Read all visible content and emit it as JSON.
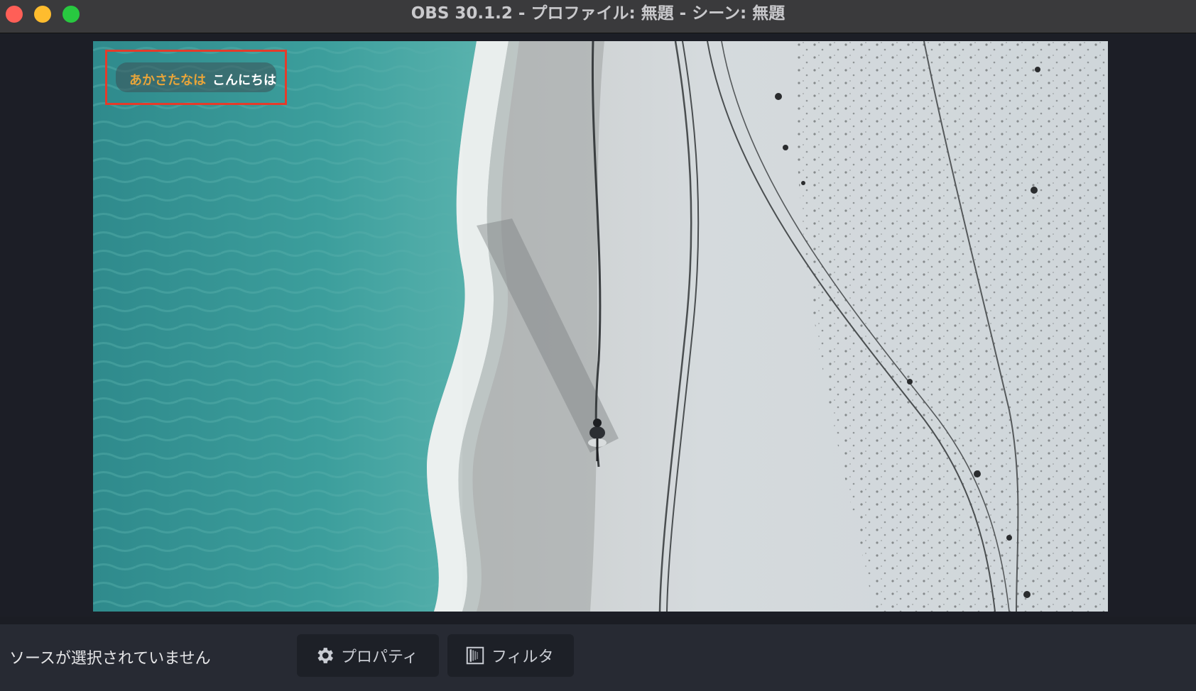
{
  "window": {
    "title": "OBS 30.1.2 - プロファイル: 無題 - シーン: 無題"
  },
  "preview": {
    "text_source": {
      "text_a": "あかさたなは",
      "text_b": "こんにちは",
      "color_a": "#e8a53a",
      "color_b": "#ffffff"
    },
    "selection_color": "#e53b2a"
  },
  "bottom": {
    "status": "ソースが選択されていません",
    "properties_label": "プロパティ",
    "properties_icon": "gear-icon",
    "filters_label": "フィルタ",
    "filters_icon": "filter-icon"
  }
}
